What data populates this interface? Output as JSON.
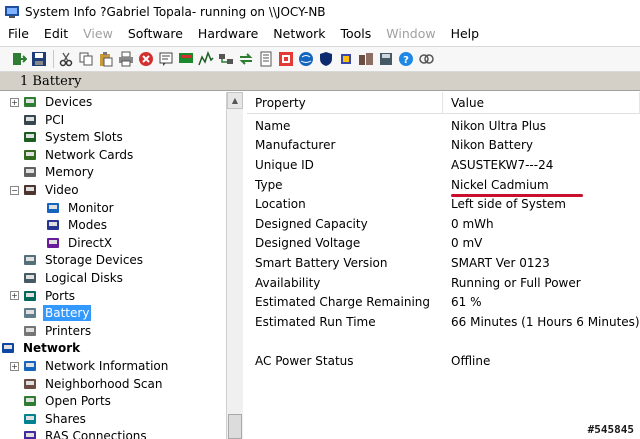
{
  "window": {
    "title": "System Info  ?Gabriel Topala- running on \\\\JOCY-NB"
  },
  "menu": [
    {
      "label": "File",
      "enabled": true
    },
    {
      "label": "Edit",
      "enabled": true
    },
    {
      "label": "View",
      "enabled": false
    },
    {
      "label": "Software",
      "enabled": true
    },
    {
      "label": "Hardware",
      "enabled": true
    },
    {
      "label": "Network",
      "enabled": true
    },
    {
      "label": "Tools",
      "enabled": true
    },
    {
      "label": "Window",
      "enabled": false
    },
    {
      "label": "Help",
      "enabled": true
    }
  ],
  "toolbar": {
    "icons": [
      "exit-icon",
      "save-icon",
      "cut-icon",
      "copy-icon",
      "paste-icon",
      "print-icon",
      "stop-icon",
      "report-icon",
      "monitor-icon",
      "graph-icon",
      "refresh-icon",
      "document-icon",
      "info-icon",
      "globe-icon",
      "shield-icon",
      "chip-icon",
      "network-icon",
      "device-icon",
      "help-icon",
      "search-icon"
    ]
  },
  "header_strip": {
    "label": "1 Battery"
  },
  "tree": {
    "items": [
      {
        "label": "Devices",
        "icon": "devices-icon",
        "expander": "+",
        "indent": 0
      },
      {
        "label": "PCI",
        "icon": "pci-icon",
        "expander": "",
        "indent": 0
      },
      {
        "label": "System Slots",
        "icon": "slots-icon",
        "expander": "",
        "indent": 0
      },
      {
        "label": "Network Cards",
        "icon": "network-card-icon",
        "expander": "",
        "indent": 0
      },
      {
        "label": "Memory",
        "icon": "memory-icon",
        "expander": "",
        "indent": 0
      },
      {
        "label": "Video",
        "icon": "video-icon",
        "expander": "−",
        "indent": 0
      },
      {
        "label": "Monitor",
        "icon": "monitor-icon",
        "expander": "",
        "indent": 1
      },
      {
        "label": "Modes",
        "icon": "modes-icon",
        "expander": "",
        "indent": 1
      },
      {
        "label": "DirectX",
        "icon": "directx-icon",
        "expander": "",
        "indent": 1
      },
      {
        "label": "Storage Devices",
        "icon": "storage-icon",
        "expander": "",
        "indent": 0
      },
      {
        "label": "Logical Disks",
        "icon": "disk-icon",
        "expander": "",
        "indent": 0
      },
      {
        "label": "Ports",
        "icon": "ports-icon",
        "expander": "+",
        "indent": 0
      },
      {
        "label": "Battery",
        "icon": "battery-icon",
        "expander": "",
        "indent": 0,
        "selected": true
      },
      {
        "label": "Printers",
        "icon": "printer-icon",
        "expander": "",
        "indent": 0
      },
      {
        "label": "Network",
        "icon": "network-icon",
        "expander": "",
        "indent": -1,
        "bold": true
      },
      {
        "label": "Network Information",
        "icon": "info-icon",
        "expander": "+",
        "indent": 0
      },
      {
        "label": "Neighborhood Scan",
        "icon": "scan-icon",
        "expander": "",
        "indent": 0
      },
      {
        "label": "Open Ports",
        "icon": "open-ports-icon",
        "expander": "",
        "indent": 0
      },
      {
        "label": "Shares",
        "icon": "shares-icon",
        "expander": "",
        "indent": 0
      },
      {
        "label": "RAS Connections",
        "icon": "ras-icon",
        "expander": "",
        "indent": 0
      }
    ]
  },
  "list": {
    "columns": [
      "Property",
      "Value"
    ],
    "rows": [
      {
        "property": "Name",
        "value": "Nikon Ultra Plus"
      },
      {
        "property": "Manufacturer",
        "value": "Nikon Battery"
      },
      {
        "property": "Unique ID",
        "value": " ASUSTEKW7---24"
      },
      {
        "property": "Type",
        "value": "Nickel Cadmium"
      },
      {
        "property": "Location",
        "value": "Left side of System"
      },
      {
        "property": "Designed Capacity",
        "value": "0 mWh"
      },
      {
        "property": "Designed Voltage",
        "value": "0 mV"
      },
      {
        "property": "Smart Battery Version",
        "value": "SMART Ver 0123"
      },
      {
        "property": "Availability",
        "value": "Running or Full Power"
      },
      {
        "property": "Estimated Charge Remaining",
        "value": "61 %"
      },
      {
        "property": "Estimated Run Time",
        "value": "66 Minutes (1 Hours 6 Minutes)"
      },
      {
        "property": "",
        "value": ""
      },
      {
        "property": "AC Power Status",
        "value": "Offline"
      }
    ]
  },
  "watermark": "#545845",
  "colors": {
    "selection": "#3399ff",
    "annotation_underline": "#c8102e"
  }
}
